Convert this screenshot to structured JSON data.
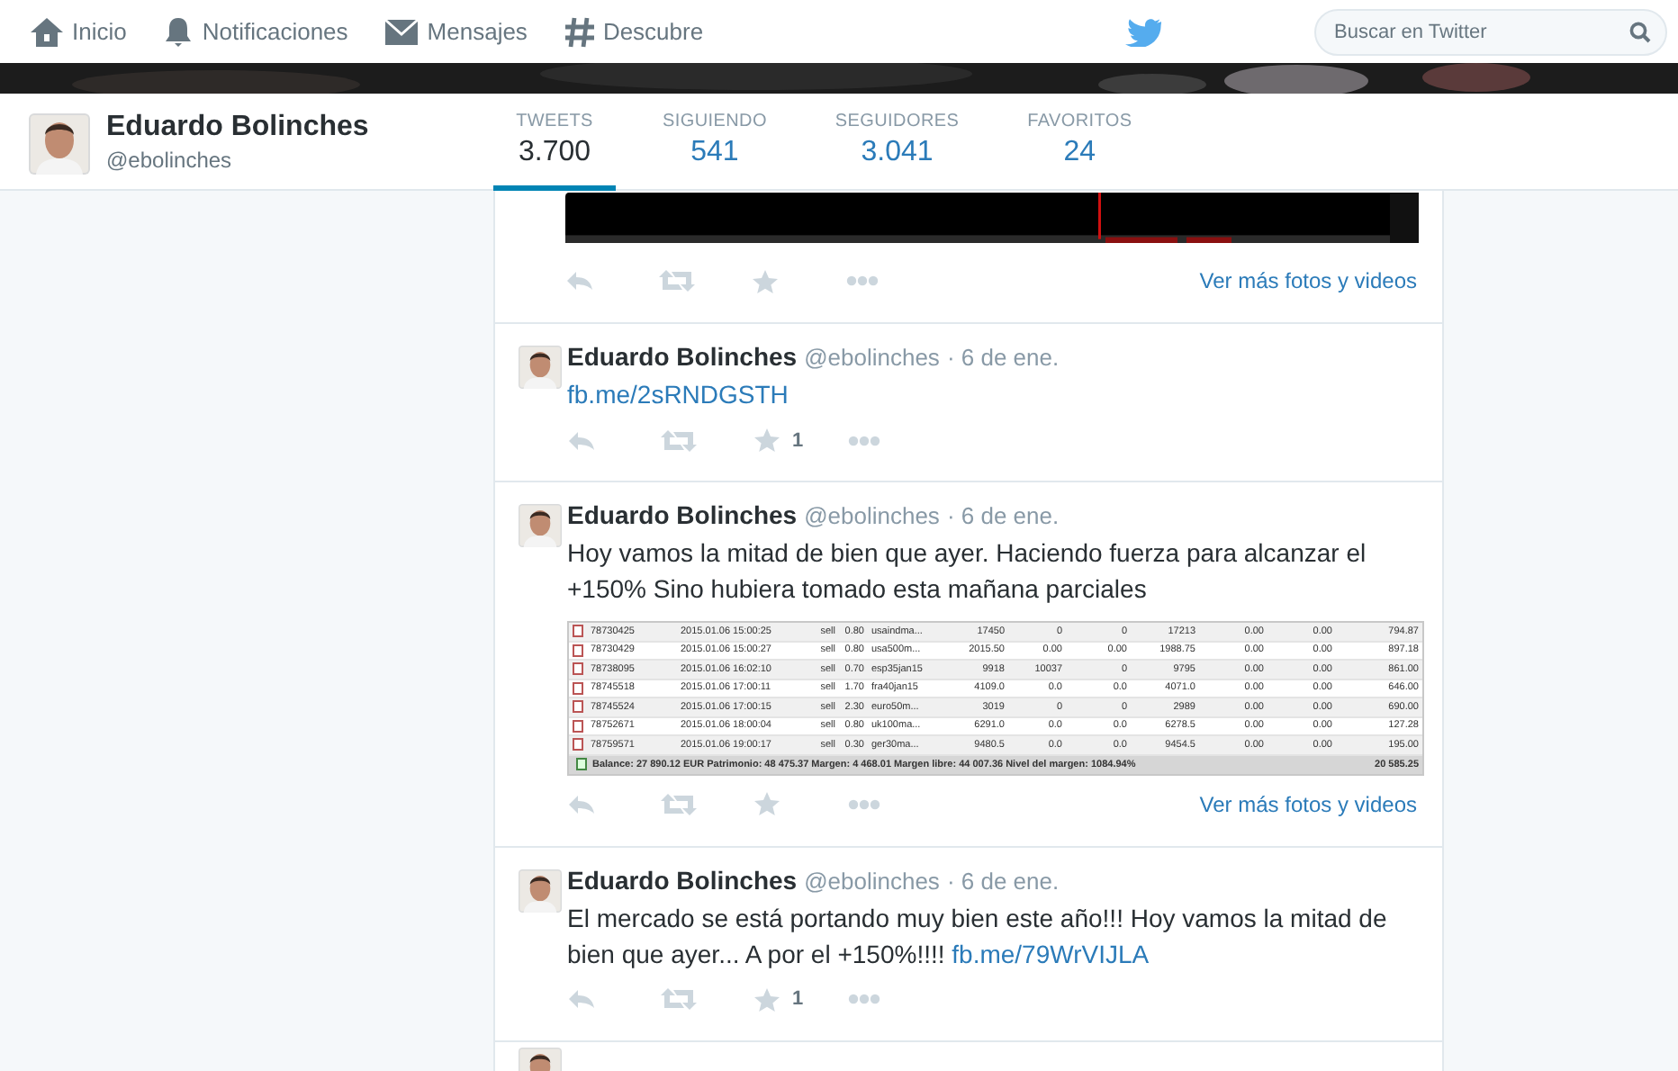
{
  "nav": [
    {
      "label": "Inicio",
      "kind": "home"
    },
    {
      "label": "Notificaciones",
      "kind": "bell"
    },
    {
      "label": "Mensajes",
      "kind": "mail"
    },
    {
      "label": "Descubre",
      "kind": "hash"
    }
  ],
  "search": {
    "placeholder": "Buscar en Twitter"
  },
  "profile": {
    "name": "Eduardo Bolinches",
    "handle": "@ebolinches"
  },
  "stats": [
    {
      "label": "TWEETS",
      "value": "3.700",
      "selected": true
    },
    {
      "label": "SIGUIENDO",
      "value": "541",
      "selected": false
    },
    {
      "label": "SEGUIDORES",
      "value": "3.041",
      "selected": false
    },
    {
      "label": "FAVORITOS",
      "value": "24",
      "selected": false
    }
  ],
  "tweets": [
    {
      "more_link": "Ver más fotos y videos"
    },
    {
      "name": "Eduardo Bolinches",
      "handle": "@ebolinches",
      "time": "· 6 de ene.",
      "link": "fb.me/2sRNDGSTH",
      "favorites": "1"
    },
    {
      "name": "Eduardo Bolinches",
      "handle": "@ebolinches",
      "time": "· 6 de ene.",
      "text": "Hoy vamos la mitad de bien que ayer. Haciendo fuerza para alcanzar el +150% Sino hubiera tomado esta mañana parciales",
      "media": {
        "kind": "table",
        "rows": [
          [
            "78730425",
            "2015.01.06 15:00:25",
            "sell",
            "0.80",
            "usaindma...",
            "17450",
            "0",
            "0",
            "17213",
            "0.00",
            "0.00",
            "794.87"
          ],
          [
            "78730429",
            "2015.01.06 15:00:27",
            "sell",
            "0.80",
            "usa500m...",
            "2015.50",
            "0.00",
            "0.00",
            "1988.75",
            "0.00",
            "0.00",
            "897.18"
          ],
          [
            "78738095",
            "2015.01.06 16:02:10",
            "sell",
            "0.70",
            "esp35jan15",
            "9918",
            "10037",
            "0",
            "9795",
            "0.00",
            "0.00",
            "861.00"
          ],
          [
            "78745518",
            "2015.01.06 17:00:11",
            "sell",
            "1.70",
            "fra40jan15",
            "4109.0",
            "0.0",
            "0.0",
            "4071.0",
            "0.00",
            "0.00",
            "646.00"
          ],
          [
            "78745524",
            "2015.01.06 17:00:15",
            "sell",
            "2.30",
            "euro50m...",
            "3019",
            "0",
            "0",
            "2989",
            "0.00",
            "0.00",
            "690.00"
          ],
          [
            "78752671",
            "2015.01.06 18:00:04",
            "sell",
            "0.80",
            "uk100ma...",
            "6291.0",
            "0.0",
            "0.0",
            "6278.5",
            "0.00",
            "0.00",
            "127.28"
          ],
          [
            "78759571",
            "2015.01.06 19:00:17",
            "sell",
            "0.30",
            "ger30ma...",
            "9480.5",
            "0.0",
            "0.0",
            "9454.5",
            "0.00",
            "0.00",
            "195.00"
          ]
        ],
        "summary": "Balance: 27 890.12 EUR  Patrimonio: 48 475.37  Margen: 4 468.01  Margen libre: 44 007.36  Nivel del margen: 1084.94%",
        "total": "20 585.25"
      },
      "more_link": "Ver más fotos y videos"
    },
    {
      "name": "Eduardo Bolinches",
      "handle": "@ebolinches",
      "time": "· 6 de ene.",
      "text": "El mercado se está portando muy bien este año!!! Hoy vamos la mitad de bien que ayer... A por el +150%!!!!",
      "link": "fb.me/79WrVIJLA",
      "favorites": "1"
    },
    {
      "avatar": true
    }
  ]
}
